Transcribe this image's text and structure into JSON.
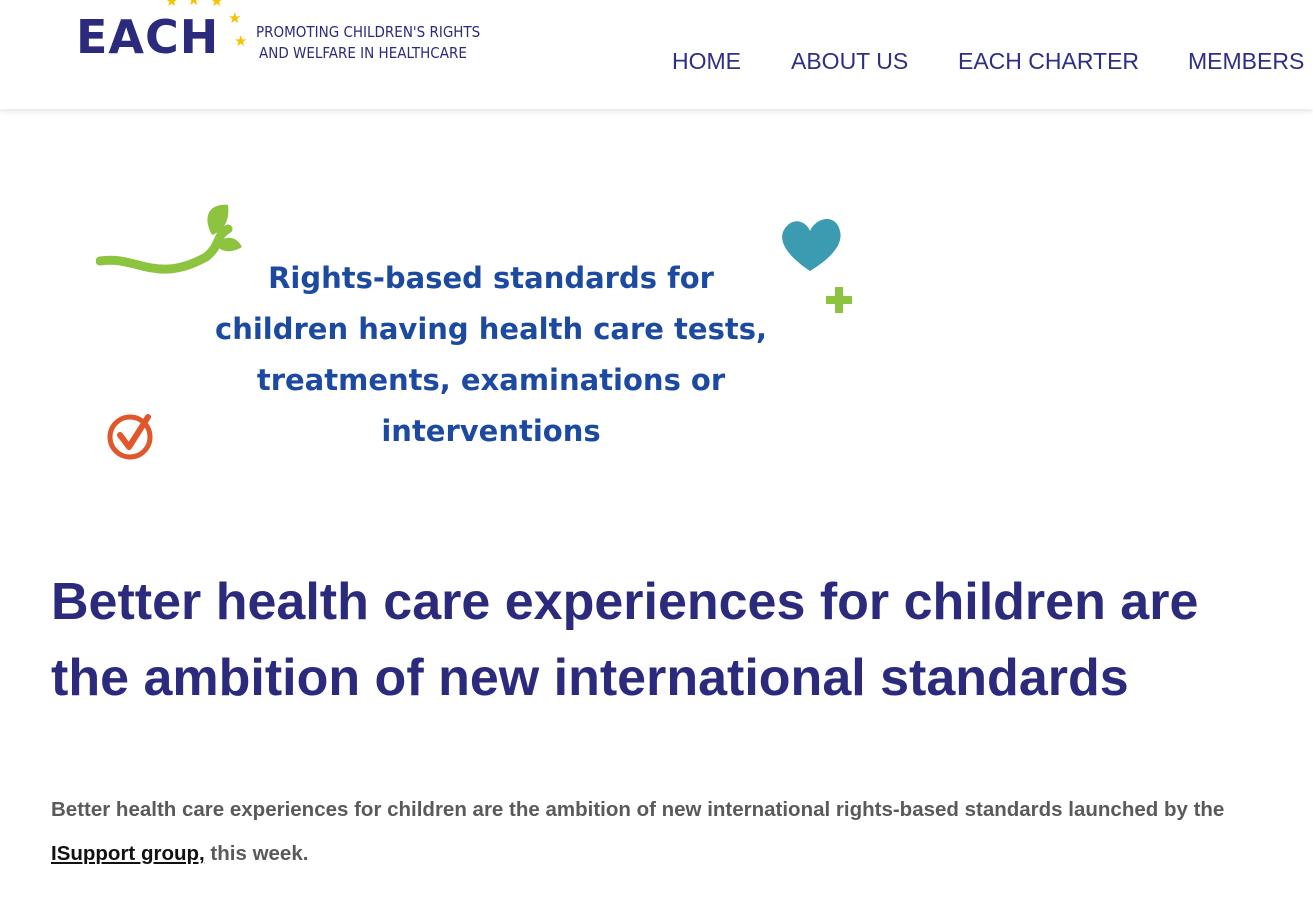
{
  "logo": {
    "word": "EACH",
    "tagline_line1": "PROMOTING CHILDREN'S RIGHTS",
    "tagline_line2": "AND WELFARE IN HEALTHCARE",
    "star_color": "#f5c400",
    "brand_color": "#2b2a7c"
  },
  "nav": {
    "items": [
      {
        "label": "HOME"
      },
      {
        "label": "ABOUT US"
      },
      {
        "label": "EACH CHARTER"
      },
      {
        "label": "MEMBERS"
      }
    ]
  },
  "hero": {
    "line1": "Rights-based standards for",
    "line2": "children having health care tests,",
    "line3": "treatments, examinations or",
    "line4": "interventions",
    "icons": [
      "leaf-sprout-icon",
      "heart-icon",
      "plus-icon",
      "checkmark-icon"
    ]
  },
  "article": {
    "headline": "Better health care experiences for children are the ambition of new international standards",
    "lead_before": "Better health care experiences for children are the ambition of new international rights-based standards launched by the",
    "lead_link": " ISupport group,",
    "lead_after": " this week."
  }
}
